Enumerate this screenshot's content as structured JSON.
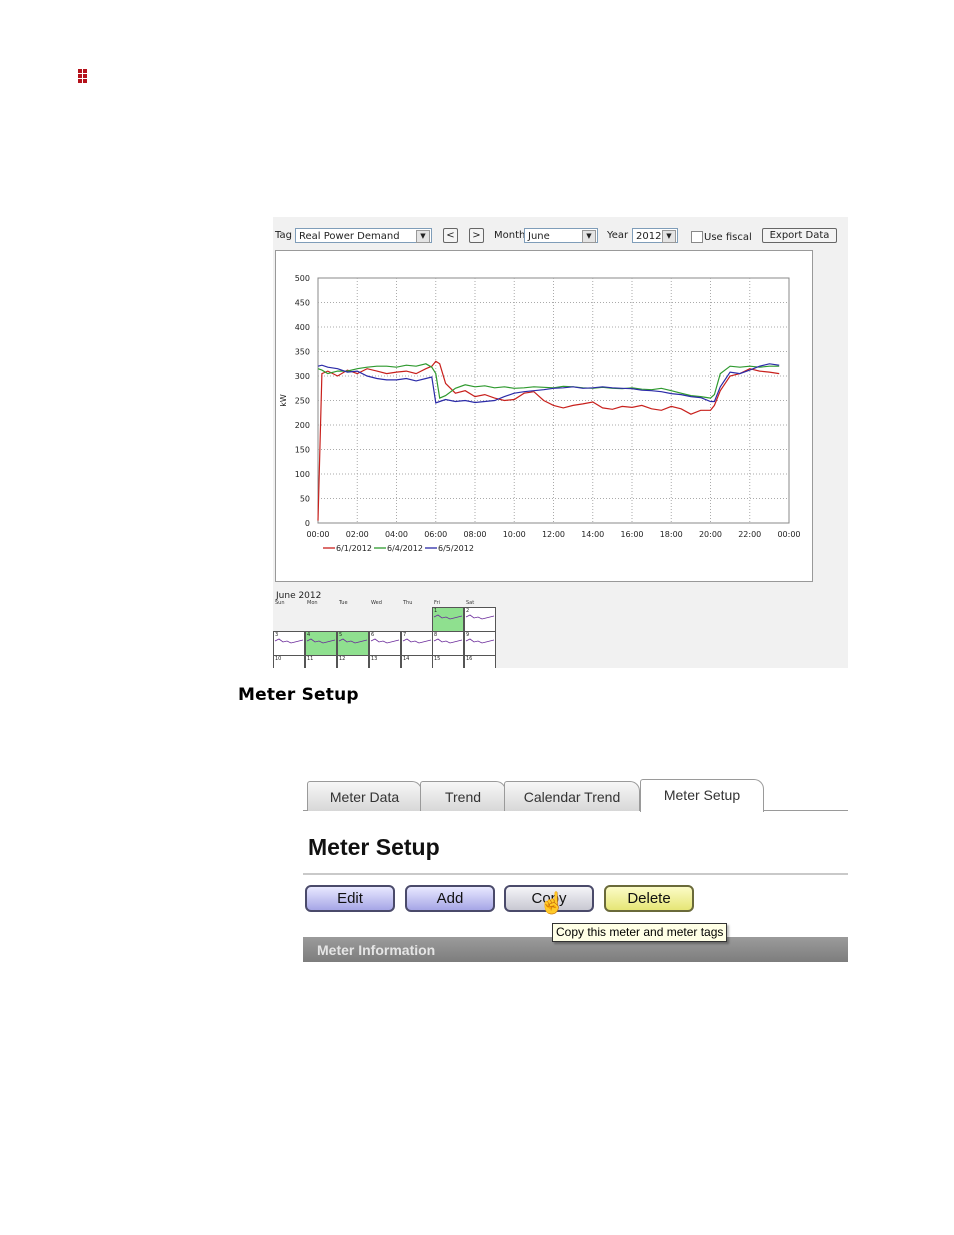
{
  "doc": {
    "section_heading": "Meter Setup"
  },
  "calendar_trend": {
    "toolbar": {
      "tag_label": "Tag",
      "tag_value": "Real Power Demand",
      "prev_label": "<",
      "next_label": ">",
      "month_label": "Month",
      "month_value": "June",
      "year_label": "Year",
      "year_value": "2012",
      "use_fiscal_label": "Use fiscal",
      "export_label": "Export Data"
    },
    "calendar": {
      "title": "June 2012",
      "day_names": [
        "Sun",
        "Mon",
        "Tue",
        "Wed",
        "Thu",
        "Fri",
        "Sat"
      ],
      "rows": [
        [
          "",
          "",
          "",
          "",
          "",
          "1",
          "2"
        ],
        [
          "3",
          "4",
          "5",
          "6",
          "7",
          "8",
          "9"
        ],
        [
          "10",
          "11",
          "12",
          "13",
          "14",
          "15",
          "16"
        ]
      ],
      "highlighted_days": [
        "1",
        "4",
        "5"
      ]
    }
  },
  "chart_data": {
    "type": "line",
    "ylabel": "kW",
    "xlabel": "",
    "ylim": [
      0,
      500
    ],
    "yticks": [
      "0",
      "50",
      "100",
      "150",
      "200",
      "250",
      "300",
      "350",
      "400",
      "450",
      "500"
    ],
    "x_ticks": [
      "00:00",
      "02:00",
      "04:00",
      "06:00",
      "08:00",
      "10:00",
      "12:00",
      "14:00",
      "16:00",
      "18:00",
      "20:00",
      "22:00",
      "00:00"
    ],
    "x_hours": [
      0,
      0.2,
      0.5,
      1,
      1.5,
      2,
      2.5,
      3,
      3.5,
      4,
      4.5,
      5,
      5.5,
      5.8,
      6,
      6.2,
      6.5,
      7,
      7.5,
      8,
      8.5,
      9,
      9.5,
      10,
      10.5,
      11,
      11.5,
      12,
      12.5,
      13,
      13.5,
      14,
      14.5,
      15,
      15.5,
      16,
      16.5,
      17,
      17.5,
      18,
      18.5,
      19,
      19.5,
      20,
      20.2,
      20.5,
      21,
      21.5,
      22,
      22.5,
      23,
      23.5
    ],
    "series": [
      {
        "name": "6/1/2012",
        "color": "#c8201c",
        "values": [
          5,
          305,
          310,
          300,
          312,
          305,
          315,
          310,
          305,
          308,
          310,
          305,
          315,
          320,
          330,
          325,
          285,
          265,
          270,
          258,
          262,
          255,
          250,
          252,
          265,
          268,
          250,
          240,
          235,
          240,
          243,
          247,
          235,
          232,
          238,
          236,
          240,
          233,
          230,
          238,
          233,
          222,
          230,
          230,
          240,
          270,
          300,
          305,
          315,
          310,
          308,
          305
        ]
      },
      {
        "name": "6/4/2012",
        "color": "#2f9a2f",
        "values": [
          315,
          312,
          305,
          310,
          310,
          315,
          318,
          320,
          320,
          318,
          322,
          320,
          325,
          318,
          305,
          255,
          260,
          275,
          282,
          278,
          280,
          276,
          278,
          275,
          276,
          278,
          277,
          276,
          279,
          278,
          276,
          275,
          277,
          275,
          274,
          276,
          273,
          272,
          275,
          270,
          265,
          260,
          258,
          255,
          262,
          305,
          320,
          318,
          320,
          318,
          320,
          320
        ]
      },
      {
        "name": "6/5/2012",
        "color": "#2b2ba8",
        "values": [
          320,
          322,
          318,
          315,
          308,
          310,
          300,
          295,
          292,
          292,
          295,
          290,
          295,
          298,
          245,
          248,
          252,
          248,
          250,
          246,
          248,
          250,
          258,
          265,
          268,
          270,
          272,
          275,
          276,
          278,
          275,
          276,
          278,
          276,
          275,
          274,
          271,
          270,
          268,
          264,
          262,
          258,
          256,
          248,
          248,
          278,
          308,
          305,
          312,
          320,
          325,
          322
        ]
      }
    ]
  },
  "meter_setup": {
    "tabs": [
      "Meter Data",
      "Trend",
      "Calendar Trend",
      "Meter Setup"
    ],
    "active_tab": "Meter Setup",
    "title": "Meter Setup",
    "buttons": {
      "edit": "Edit",
      "add": "Add",
      "copy": "Copy",
      "delete": "Delete"
    },
    "tooltip": "Copy this meter and meter tags",
    "section_bar": "Meter Information"
  }
}
